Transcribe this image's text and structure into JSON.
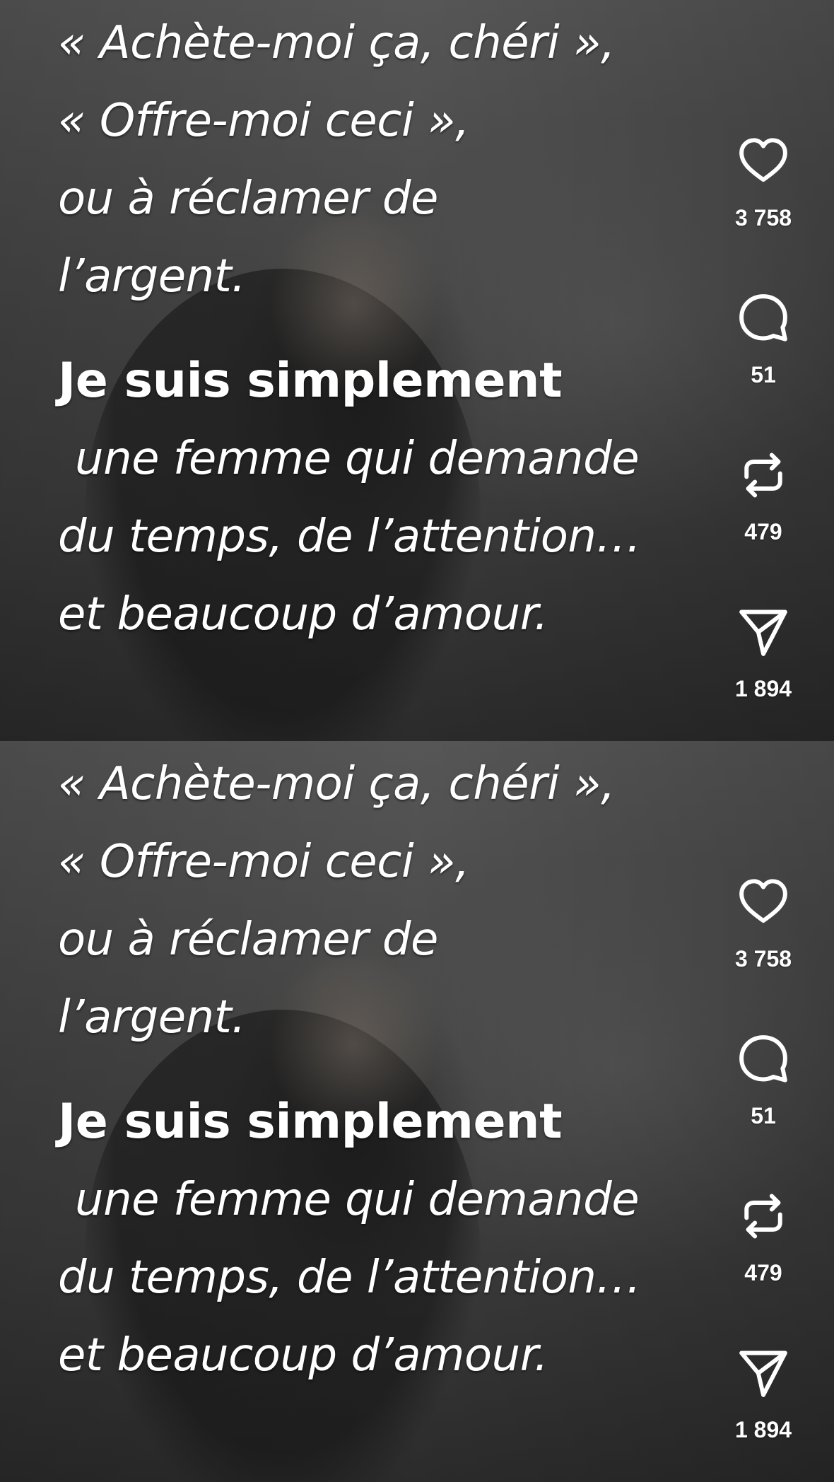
{
  "panels": [
    {
      "caption": {
        "line1": "« Achète-moi ça, chéri »,",
        "line2": "« Offre-moi ceci »,",
        "line3": "ou à réclamer de",
        "line4": "l’argent.",
        "line5": "Je suis simplement",
        "line6": "une femme qui demande",
        "line7": "du temps, de l’attention…",
        "line8": "et beaucoup d’amour."
      },
      "actions": {
        "like_count": "3 758",
        "comment_count": "51",
        "repost_count": "479",
        "share_count": "1 894"
      }
    },
    {
      "caption": {
        "line1": "« Achète-moi ça, chéri »,",
        "line2": "« Offre-moi ceci »,",
        "line3": "ou à réclamer de",
        "line4": "l’argent.",
        "line5": "Je suis simplement",
        "line6": "une femme qui demande",
        "line7": "du temps, de l’attention…",
        "line8": "et beaucoup d’amour."
      },
      "actions": {
        "like_count": "3 758",
        "comment_count": "51",
        "repost_count": "479",
        "share_count": "1 894"
      }
    }
  ],
  "icons": {
    "like": "heart-icon",
    "comment": "comment-bubble-icon",
    "repost": "repost-icon",
    "share": "send-icon"
  },
  "colors": {
    "text": "#ffffff",
    "background": "#3a3a3a"
  }
}
